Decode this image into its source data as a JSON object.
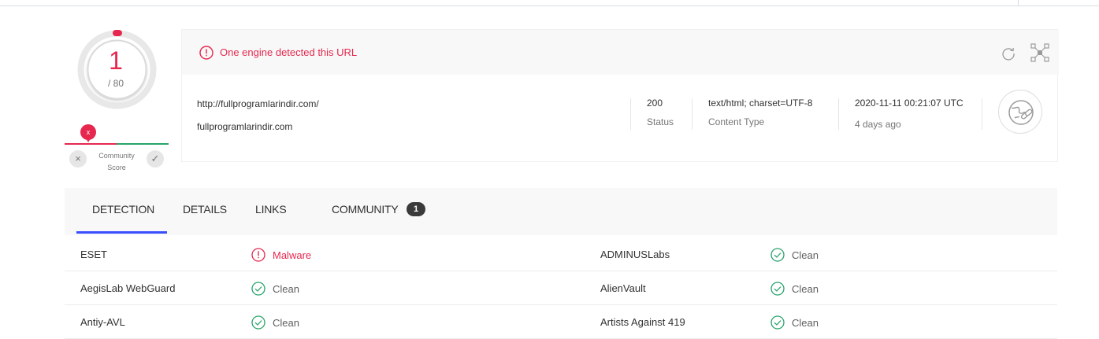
{
  "score": {
    "detections": "1",
    "total": "/ 80"
  },
  "community": {
    "label_line1": "Community",
    "label_line2": "Score",
    "marker": "x",
    "down_glyph": "×",
    "up_glyph": "✓"
  },
  "header": {
    "alert": "One engine detected this URL",
    "url": "http://fullprogramlarindir.com/",
    "domain": "fullprogramlarindir.com",
    "status_value": "200",
    "status_label": "Status",
    "content_type_value": "text/html; charset=UTF-8",
    "content_type_label": "Content Type",
    "date_value": "2020-11-11 00:21:07 UTC",
    "date_ago": "4 days ago"
  },
  "tabs": [
    {
      "label": "DETECTION",
      "active": true
    },
    {
      "label": "DETAILS"
    },
    {
      "label": "LINKS"
    },
    {
      "label": "COMMUNITY",
      "badge": "1"
    }
  ],
  "results": [
    {
      "left_engine": "ESET",
      "left_result": "Malware",
      "left_status": "malware",
      "right_engine": "ADMINUSLabs",
      "right_result": "Clean",
      "right_status": "clean"
    },
    {
      "left_engine": "AegisLab WebGuard",
      "left_result": "Clean",
      "left_status": "clean",
      "right_engine": "AlienVault",
      "right_result": "Clean",
      "right_status": "clean"
    },
    {
      "left_engine": "Antiy-AVL",
      "left_result": "Clean",
      "left_status": "clean",
      "right_engine": "Artists Against 419",
      "right_result": "Clean",
      "right_status": "clean"
    }
  ],
  "colors": {
    "malicious": "#e6284f",
    "clean": "#29a46b",
    "accent": "#394eff"
  },
  "icons": {
    "alert": "alert-circle-icon",
    "reanalyze": "refresh-icon",
    "graph": "graph-icon",
    "globe": "globe-link-icon",
    "clean": "check-circle-icon",
    "malware": "alert-circle-icon"
  }
}
